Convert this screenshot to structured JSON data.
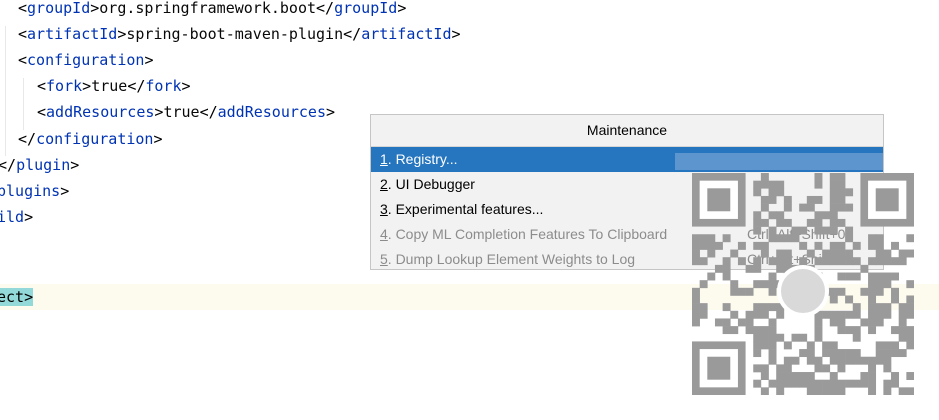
{
  "editor": {
    "lines": [
      {
        "parts": [
          [
            "b",
            "<"
          ],
          [
            "n",
            "groupId"
          ],
          [
            "b",
            ">"
          ],
          [
            "t",
            "org.springframework.boot"
          ],
          [
            "b",
            "</"
          ],
          [
            "n",
            "groupId"
          ],
          [
            "b",
            ">"
          ]
        ]
      },
      {
        "parts": [
          [
            "b",
            "<"
          ],
          [
            "n",
            "artifactId"
          ],
          [
            "b",
            ">"
          ],
          [
            "t",
            "spring-boot-maven-plugin"
          ],
          [
            "b",
            "</"
          ],
          [
            "n",
            "artifactId"
          ],
          [
            "b",
            ">"
          ]
        ]
      },
      {
        "parts": [
          [
            "b",
            "<"
          ],
          [
            "n",
            "configuration"
          ],
          [
            "b",
            ">"
          ]
        ]
      },
      {
        "parts": [
          [
            "b",
            "<"
          ],
          [
            "n",
            "fork"
          ],
          [
            "b",
            ">"
          ],
          [
            "t",
            "true"
          ],
          [
            "b",
            "</"
          ],
          [
            "n",
            "fork"
          ],
          [
            "b",
            ">"
          ]
        ]
      },
      {
        "parts": [
          [
            "b",
            "<"
          ],
          [
            "n",
            "addResources"
          ],
          [
            "b",
            ">"
          ],
          [
            "t",
            "true"
          ],
          [
            "b",
            "</"
          ],
          [
            "n",
            "addResources"
          ],
          [
            "b",
            ">"
          ]
        ]
      },
      {
        "parts": [
          [
            "b",
            "</"
          ],
          [
            "n",
            "configuration"
          ],
          [
            "b",
            ">"
          ]
        ]
      },
      {
        "parts": [
          [
            "b",
            "</"
          ],
          [
            "n",
            "plugin"
          ],
          [
            "b",
            ">"
          ]
        ]
      },
      {
        "parts": [
          [
            "n",
            "plugins"
          ],
          [
            "b",
            ">"
          ]
        ]
      },
      {
        "parts": [
          [
            "n",
            "ild"
          ],
          [
            "b",
            ">"
          ]
        ]
      },
      {
        "parts": []
      },
      {
        "parts": [
          [
            "h",
            "ect>"
          ]
        ]
      }
    ]
  },
  "popup": {
    "title": "Maintenance",
    "items": [
      {
        "mnemonic": "1",
        "label": ". Registry...",
        "shortcut": "",
        "state": "selected"
      },
      {
        "mnemonic": "2",
        "label": ". UI Debugger",
        "shortcut": "",
        "state": "enabled"
      },
      {
        "mnemonic": "3",
        "label": ". Experimental features...",
        "shortcut": "",
        "state": "enabled"
      },
      {
        "mnemonic": "4",
        "label": ". Copy ML Completion Features To Clipboard",
        "shortcut": "Ctrl+Alt+Shift+0",
        "state": "disabled"
      },
      {
        "mnemonic": "5",
        "label": ". Dump Lookup Element Weights to Log",
        "shortcut": "Ctrl+Alt+Shift+W",
        "state": "disabled"
      }
    ]
  },
  "colors": {
    "tag_name": "#0033b3",
    "selection": "#2675bf",
    "bracket_match": "#93d9d9",
    "current_line": "#fdfbee"
  },
  "overlay": {
    "icon": "qr-code-icon"
  }
}
